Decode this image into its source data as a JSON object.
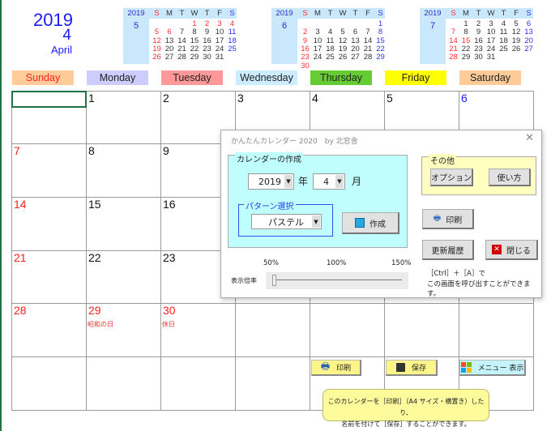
{
  "header": {
    "year": "2019",
    "month": "4",
    "month_name": "April"
  },
  "mini_calendars": [
    {
      "year": "2019",
      "month": "5",
      "first_dow": 3,
      "days": 31,
      "holidays": [
        1,
        2,
        3,
        4,
        5,
        6
      ]
    },
    {
      "year": "2019",
      "month": "6",
      "first_dow": 6,
      "days": 30,
      "holidays": []
    },
    {
      "year": "2019",
      "month": "7",
      "first_dow": 1,
      "days": 31,
      "holidays": [
        15
      ]
    }
  ],
  "mini_dow": [
    "S",
    "M",
    "T",
    "W",
    "T",
    "F",
    "S"
  ],
  "weekdays": [
    {
      "label": "Sunday",
      "bg": "#ffcc99",
      "color": "#ff2020"
    },
    {
      "label": "Monday",
      "bg": "#ccccff",
      "color": "#222222"
    },
    {
      "label": "Tuesday",
      "bg": "#ff9999",
      "color": "#222222"
    },
    {
      "label": "Wednesday",
      "bg": "#ccecff",
      "color": "#222222"
    },
    {
      "label": "Thursday",
      "bg": "#66cc33",
      "color": "#222222"
    },
    {
      "label": "Friday",
      "bg": "#ffff00",
      "color": "#222222"
    },
    {
      "label": "Saturday",
      "bg": "#ffcc99",
      "color": "#222222"
    }
  ],
  "calendar": {
    "first_dow": 1,
    "days": 30,
    "holidays": {
      "29": "昭和の日",
      "30": "休日"
    },
    "holiday_days": [
      29,
      30
    ]
  },
  "dialog": {
    "title": "かんたんカレンダー 2020　by 北窓舎",
    "create_group": "カレンダーの作成",
    "year_value": "2019",
    "year_unit": "年",
    "month_value": "4",
    "month_unit": "月",
    "pattern_group": "パターン選択",
    "pattern_value": "パステル",
    "create_button": "作成",
    "other_group": "その他",
    "options_button": "オプション",
    "howto_button": "使い方",
    "print_button": "印刷",
    "history_button": "更新履歴",
    "close_button": "閉じる",
    "zoom_label": "表示倍率",
    "zoom_ticks": [
      "50%",
      "100%",
      "150%"
    ],
    "zoom_value_percent": 50,
    "hint_line1": "［Ctrl］＋［A］で",
    "hint_line2": "この画面を呼び出すことができます。"
  },
  "sheet_buttons": {
    "print": "印刷",
    "save": "保存",
    "menu": "メニュー 表示"
  },
  "tooltip": {
    "line1": "このカレンダーを［印刷］（A4 サイズ・横置き）したり、",
    "line2": "名前を付けて［保存］することができます。"
  }
}
